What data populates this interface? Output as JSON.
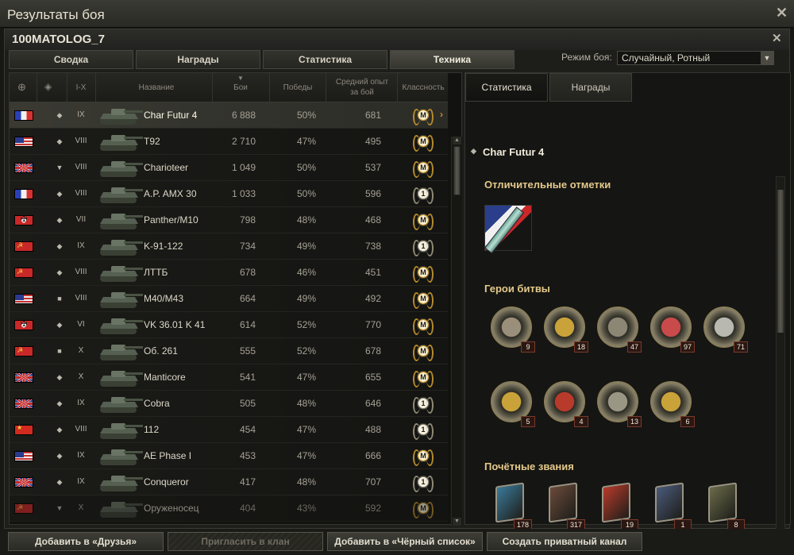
{
  "window": {
    "title": "Результаты боя"
  },
  "player": {
    "name": "100MATOLOG_7"
  },
  "tabs": [
    "Сводка",
    "Награды",
    "Статистика",
    "Техника"
  ],
  "battle_mode": {
    "label": "Режим боя:",
    "value": "Случайный, Ротный"
  },
  "table": {
    "headers": {
      "tier": "I-X",
      "name": "Название",
      "battles": "Бои",
      "wins": "Победы",
      "xp": "Средний опыт за бой",
      "mastery": "Классность"
    },
    "rows": [
      {
        "nation": "fr",
        "type": "heavy",
        "tier": "IX",
        "name": "Char Futur 4",
        "battles": "6 888",
        "wins": "50%",
        "xp": "681",
        "mastery": "M",
        "selected": true
      },
      {
        "nation": "us",
        "type": "heavy",
        "tier": "VIII",
        "name": "T92",
        "battles": "2 710",
        "wins": "47%",
        "xp": "495",
        "mastery": "M"
      },
      {
        "nation": "uk",
        "type": "td",
        "tier": "VIII",
        "name": "Charioteer",
        "battles": "1 049",
        "wins": "50%",
        "xp": "537",
        "mastery": "M"
      },
      {
        "nation": "fr",
        "type": "heavy",
        "tier": "VIII",
        "name": "A.P. AMX 30",
        "battles": "1 033",
        "wins": "50%",
        "xp": "596",
        "mastery": "1"
      },
      {
        "nation": "de",
        "type": "heavy",
        "tier": "VII",
        "name": "Panther/M10",
        "battles": "798",
        "wins": "48%",
        "xp": "468",
        "mastery": "M"
      },
      {
        "nation": "su",
        "type": "heavy",
        "tier": "IX",
        "name": "K-91-122",
        "battles": "734",
        "wins": "49%",
        "xp": "738",
        "mastery": "1"
      },
      {
        "nation": "su",
        "type": "heavy",
        "tier": "VIII",
        "name": "ЛТТБ",
        "battles": "678",
        "wins": "46%",
        "xp": "451",
        "mastery": "M"
      },
      {
        "nation": "us",
        "type": "spg",
        "tier": "VIII",
        "name": "M40/M43",
        "battles": "664",
        "wins": "49%",
        "xp": "492",
        "mastery": "M"
      },
      {
        "nation": "de",
        "type": "medium",
        "tier": "VI",
        "name": "VK 36.01 K 41",
        "battles": "614",
        "wins": "52%",
        "xp": "770",
        "mastery": "M"
      },
      {
        "nation": "su",
        "type": "spg",
        "tier": "X",
        "name": "Об. 261",
        "battles": "555",
        "wins": "52%",
        "xp": "678",
        "mastery": "M"
      },
      {
        "nation": "uk",
        "type": "heavy",
        "tier": "X",
        "name": "Manticore",
        "battles": "541",
        "wins": "47%",
        "xp": "655",
        "mastery": "M"
      },
      {
        "nation": "uk",
        "type": "heavy",
        "tier": "IX",
        "name": "Cobra",
        "battles": "505",
        "wins": "48%",
        "xp": "646",
        "mastery": "1"
      },
      {
        "nation": "cn",
        "type": "medium",
        "tier": "VIII",
        "name": "112",
        "battles": "454",
        "wins": "47%",
        "xp": "488",
        "mastery": "1"
      },
      {
        "nation": "us",
        "type": "medium",
        "tier": "IX",
        "name": "AE Phase I",
        "battles": "453",
        "wins": "47%",
        "xp": "666",
        "mastery": "M"
      },
      {
        "nation": "uk",
        "type": "medium",
        "tier": "IX",
        "name": "Conqueror",
        "battles": "417",
        "wins": "48%",
        "xp": "707",
        "mastery": "1"
      },
      {
        "nation": "su",
        "type": "td",
        "tier": "X",
        "name": "Оруженосец",
        "battles": "404",
        "wins": "43%",
        "xp": "592",
        "mastery": "M"
      }
    ]
  },
  "right": {
    "tabs": [
      "Статистика",
      "Награды"
    ],
    "tank_title": "Char Futur 4",
    "sections": {
      "marks": "Отличительные отметки",
      "heroes": "Герои битвы",
      "ranks": "Почётные звания"
    },
    "heroes": [
      {
        "icon": "medal-sword-icon",
        "count": "9",
        "color": "#9a8f7a"
      },
      {
        "icon": "medal-tank-gold-icon",
        "count": "18",
        "color": "#c9a23a"
      },
      {
        "icon": "medal-three-tanks-icon",
        "count": "47",
        "color": "#8c8774"
      },
      {
        "icon": "medal-red-cross-icon",
        "count": "97",
        "color": "#c84a4a"
      },
      {
        "icon": "medal-cannon-burst-icon",
        "count": "71",
        "color": "#b8b8b0"
      },
      {
        "icon": "medal-tank-shield-icon",
        "count": "5",
        "color": "#c9a23a"
      },
      {
        "icon": "medal-red-shield-icon",
        "count": "4",
        "color": "#b83a2a"
      },
      {
        "icon": "medal-tank-wreath-icon",
        "count": "13",
        "color": "#9a9684"
      },
      {
        "icon": "medal-star-tank-icon",
        "count": "6",
        "color": "#c9a23a"
      }
    ],
    "ranks": [
      {
        "icon": "rank-blue-emblem-icon",
        "count": "178",
        "color": "#3a7a9a"
      },
      {
        "icon": "rank-tank-duel-icon",
        "count": "317",
        "color": "#6a4a3a"
      },
      {
        "icon": "rank-red-star-icon",
        "count": "19",
        "color": "#b83a2a"
      },
      {
        "icon": "rank-blue-tanks-icon",
        "count": "1",
        "color": "#4a5a7a"
      },
      {
        "icon": "rank-chevron-icon",
        "count": "8",
        "color": "#6a6a4a"
      }
    ]
  },
  "buttons": {
    "friends": "Добавить в «Друзья»",
    "clan": "Пригласить в клан",
    "blacklist": "Добавить в «Чёрный список»",
    "private": "Создать приватный канал"
  }
}
